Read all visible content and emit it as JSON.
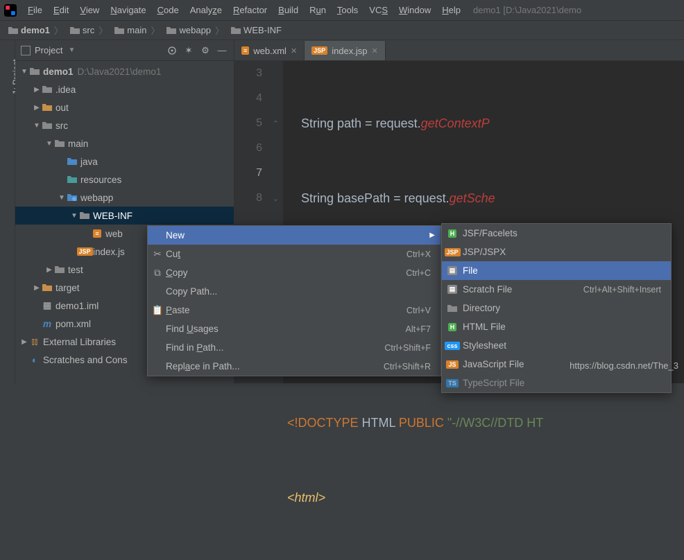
{
  "menubar": {
    "items": [
      "File",
      "Edit",
      "View",
      "Navigate",
      "Code",
      "Analyze",
      "Refactor",
      "Build",
      "Run",
      "Tools",
      "VCS",
      "Window",
      "Help"
    ],
    "project_path": "demo1 [D:\\Java2021\\demo"
  },
  "breadcrumb": {
    "items": [
      "demo1",
      "src",
      "main",
      "webapp",
      "WEB-INF"
    ]
  },
  "left_stripe": {
    "label": "1: Project"
  },
  "proj_header": {
    "title": "Project"
  },
  "tree": {
    "n0": {
      "label": "demo1",
      "path": "D:\\Java2021\\demo1"
    },
    "n1": {
      "label": ".idea"
    },
    "n2": {
      "label": "out"
    },
    "n3": {
      "label": "src"
    },
    "n4": {
      "label": "main"
    },
    "n5": {
      "label": "java"
    },
    "n6": {
      "label": "resources"
    },
    "n7": {
      "label": "webapp"
    },
    "n8": {
      "label": "WEB-INF"
    },
    "n9": {
      "label": "web"
    },
    "n10": {
      "label": "index.js"
    },
    "n11": {
      "label": "test"
    },
    "n12": {
      "label": "target"
    },
    "n13": {
      "label": "demo1.iml"
    },
    "n14": {
      "label": "pom.xml"
    },
    "n15": {
      "label": "External Libraries"
    },
    "n16": {
      "label": "Scratches and Cons"
    }
  },
  "tabs": {
    "t0": {
      "label": "web.xml"
    },
    "t1": {
      "label": "index.jsp"
    }
  },
  "gutter": [
    "3",
    "4",
    "5",
    "6",
    "7",
    "8"
  ],
  "code": {
    "l3a": "    String path = request.",
    "l3b": "getContextP",
    "l4a": "    String basePath = request.",
    "l4b": "getSche",
    "l5": "%>",
    "l7a": "<!DOCTYPE",
    "l7b": " HTML ",
    "l7c": "PUBLIC",
    "l7d": " \"-//W3C//DTD HT",
    "l8": "<html>"
  },
  "ctx": {
    "new": "New",
    "cut": "Cut",
    "cut_s": "Ctrl+X",
    "copy": "Copy",
    "copy_s": "Ctrl+C",
    "copy_path": "Copy Path...",
    "paste": "Paste",
    "paste_s": "Ctrl+V",
    "find_usages": "Find Usages",
    "find_usages_s": "Alt+F7",
    "find_in_path": "Find in Path...",
    "find_in_path_s": "Ctrl+Shift+F",
    "replace_in_path": "Replace in Path...",
    "replace_in_path_s": "Ctrl+Shift+R"
  },
  "submenu": {
    "jsf": "JSF/Facelets",
    "jspx": "JSP/JSPX",
    "file": "File",
    "scratch": "Scratch File",
    "scratch_s": "Ctrl+Alt+Shift+Insert",
    "dir": "Directory",
    "html": "HTML File",
    "css": "Stylesheet",
    "js": "JavaScript File",
    "ts": "TypeScript File"
  },
  "watermark": "https://blog.csdn.net/The_3"
}
